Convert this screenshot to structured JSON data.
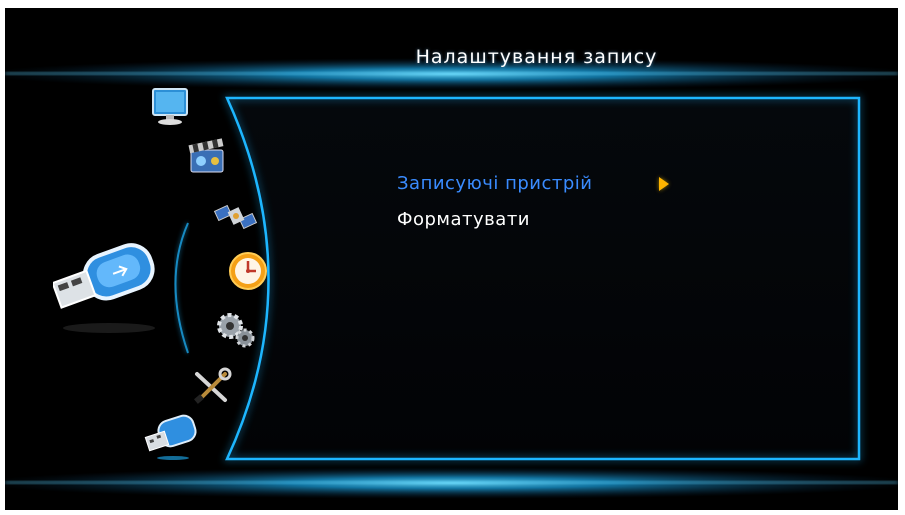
{
  "header": {
    "title": "Налаштування запису"
  },
  "sidebar": {
    "items": [
      {
        "name": "monitor-icon",
        "label": "Monitor"
      },
      {
        "name": "media-icon",
        "label": "Media"
      },
      {
        "name": "satellite-icon",
        "label": "Satellite"
      },
      {
        "name": "clock-icon",
        "label": "Timer"
      },
      {
        "name": "gears-icon",
        "label": "System"
      },
      {
        "name": "tools-icon",
        "label": "Tools"
      },
      {
        "name": "usb-icon",
        "label": "USB"
      }
    ],
    "active": "usb-icon"
  },
  "menu": {
    "items": [
      {
        "label": "Записуючі пристрій",
        "selected": true,
        "has_submenu": true
      },
      {
        "label": "Форматувати",
        "selected": false,
        "has_submenu": false
      }
    ]
  },
  "colors": {
    "background": "#000000",
    "accent_glow": "#1fb6ff",
    "selected_text": "#3a8cff",
    "normal_text": "#ffffff",
    "arrow": "#ffb400"
  }
}
